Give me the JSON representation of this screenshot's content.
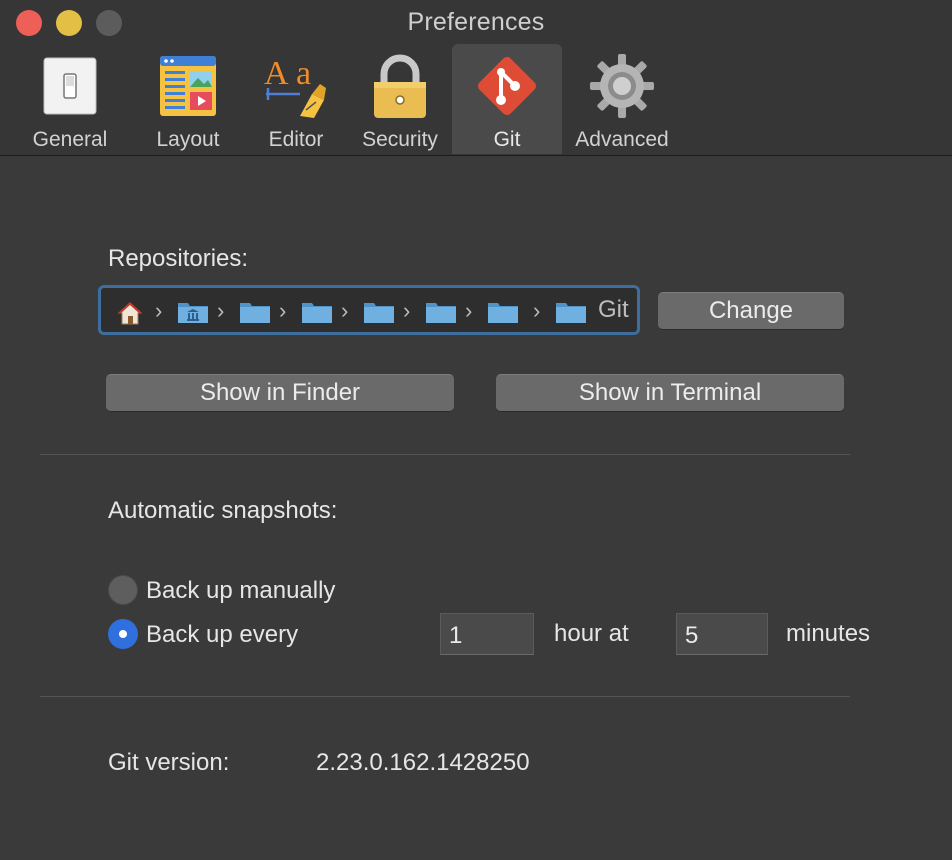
{
  "window": {
    "title": "Preferences"
  },
  "toolbar": {
    "tabs": [
      {
        "label": "General",
        "icon": "switch-icon"
      },
      {
        "label": "Layout",
        "icon": "layout-icon"
      },
      {
        "label": "Editor",
        "icon": "font-pen-icon"
      },
      {
        "label": "Security",
        "icon": "padlock-icon"
      },
      {
        "label": "Git",
        "icon": "git-icon",
        "selected": true
      },
      {
        "label": "Advanced",
        "icon": "gear-icon"
      }
    ]
  },
  "repositories": {
    "label": "Repositories:",
    "path_items": [
      "home-folder",
      "library-folder",
      "folder",
      "folder",
      "folder",
      "folder",
      "folder",
      "folder"
    ],
    "path_last": "Git",
    "change_label": "Change",
    "show_finder_label": "Show in Finder",
    "show_terminal_label": "Show in Terminal"
  },
  "snapshots": {
    "label": "Automatic snapshots:",
    "manual_label": "Back up manually",
    "every_label": "Back up every",
    "selected": "every",
    "hours_value": "1",
    "hours_unit": "hour at",
    "minutes_value": "5",
    "minutes_unit": "minutes"
  },
  "git_version": {
    "label": "Git version:",
    "value": "2.23.0.162.1428250"
  },
  "colors": {
    "accent": "#2f6fde",
    "focus_ring": "#3e6e9e",
    "git_red": "#de4c36"
  }
}
